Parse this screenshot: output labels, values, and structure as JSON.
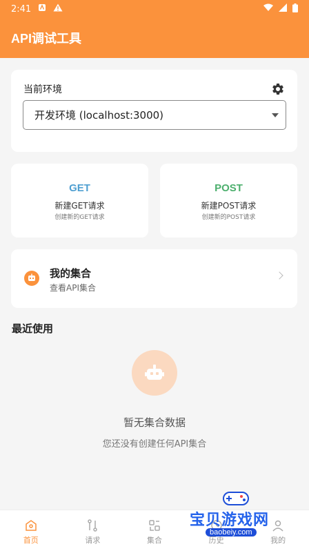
{
  "status_bar": {
    "time": "2:41"
  },
  "app_bar": {
    "title": "API调试工具"
  },
  "environment": {
    "label": "当前环境",
    "selected": "开发环境 (localhost:3000)"
  },
  "requests": [
    {
      "method": "GET",
      "title": "新建GET请求",
      "subtitle": "创建新的GET请求",
      "color": "#4f9fd1"
    },
    {
      "method": "POST",
      "title": "新建POST请求",
      "subtitle": "创建新的POST请求",
      "color": "#4caf6d"
    }
  ],
  "collections": {
    "title": "我的集合",
    "subtitle": "查看API集合"
  },
  "recent": {
    "heading": "最近使用",
    "empty_title": "暂无集合数据",
    "empty_subtitle": "您还没有创建任何API集合"
  },
  "nav": [
    {
      "label": "首页",
      "icon": "home-icon"
    },
    {
      "label": "请求",
      "icon": "request-icon"
    },
    {
      "label": "集合",
      "icon": "collection-icon"
    },
    {
      "label": "历史",
      "icon": "history-icon"
    },
    {
      "label": "我的",
      "icon": "profile-icon"
    }
  ],
  "watermark": {
    "text": "宝贝游戏网",
    "url": "baobeiy.com"
  },
  "colors": {
    "accent": "#fb923c",
    "get": "#4f9fd1",
    "post": "#4caf6d"
  }
}
